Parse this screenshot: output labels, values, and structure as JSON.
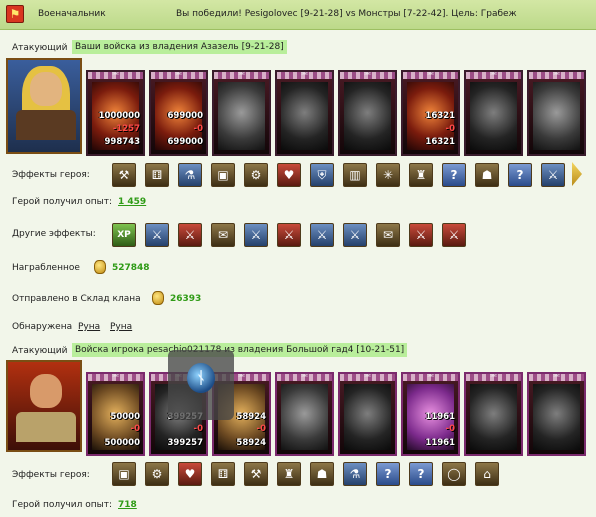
{
  "titlebar": {
    "left_label": "Военачальник",
    "battle_text": "Вы победили! Pesigolovec [9-21-28] vs Монстры [7-22-42]. Цель: Грабеж"
  },
  "attacker1": {
    "role_label": "Атакующий",
    "source_text": "Ваши войска из владения Азазель [9-21-28]",
    "units": [
      {
        "count": "1000000",
        "loss": "-1257",
        "left": "998743"
      },
      {
        "count": "699000",
        "loss": "-0",
        "left": "699000"
      },
      {
        "count": "",
        "loss": "",
        "left": ""
      },
      {
        "count": "",
        "loss": "",
        "left": ""
      },
      {
        "count": "",
        "loss": "",
        "left": ""
      },
      {
        "count": "16321",
        "loss": "-0",
        "left": "16321"
      },
      {
        "count": "",
        "loss": "",
        "left": ""
      },
      {
        "count": "",
        "loss": "",
        "left": ""
      }
    ],
    "hero_effects_label": "Эффекты героя:",
    "hero_effect_icons": [
      "hammer-icon",
      "dice-icon",
      "potion-icon",
      "chest-icon",
      "grinder-icon",
      "heart-icon",
      "shield-icon",
      "barrel-icon",
      "web-icon",
      "armor-icon",
      "question-icon",
      "helmet-icon",
      "question-icon",
      "sword-icon"
    ],
    "exp_label": "Герой получил опыт:",
    "exp_value": "1 459",
    "other_effects_label": "Другие эффекты:",
    "other_effect_icons": [
      "xp-icon",
      "sword-icon",
      "sword-fire-icon",
      "scroll-icon",
      "sword-icon",
      "sword-fire-icon",
      "sword-icon",
      "sword-icon",
      "scroll-icon",
      "sword-fire-icon",
      "sword-fire-icon"
    ],
    "xp_icon_text": "XP",
    "loot_label": "Награбленное",
    "loot_value": "527848",
    "sent_label": "Отправлено в Склад клана",
    "sent_value": "26393",
    "found_label": "Обнаружена",
    "found_items": [
      "Руна",
      "Руна"
    ]
  },
  "attacker2": {
    "role_label": "Атакующий",
    "source_text": "Войска игрока pesachio021178 из владения Большой гад4 [10-21-51]",
    "units": [
      {
        "count": "50000",
        "loss": "-0",
        "left": "500000"
      },
      {
        "count": "399257",
        "loss": "-0",
        "left": "399257"
      },
      {
        "count": "58924",
        "loss": "-0",
        "left": "58924"
      },
      {
        "count": "",
        "loss": "",
        "left": ""
      },
      {
        "count": "",
        "loss": "",
        "left": ""
      },
      {
        "count": "11961",
        "loss": "-0",
        "left": "11961"
      },
      {
        "count": "",
        "loss": "",
        "left": ""
      },
      {
        "count": "",
        "loss": "",
        "left": ""
      }
    ],
    "hero_effects_label": "Эффекты героя:",
    "hero_effect_icons": [
      "chest-icon",
      "grinder-icon",
      "heart-icon",
      "dice-icon",
      "hammer-icon",
      "armor-icon",
      "helmet-icon",
      "potion-icon",
      "question-icon",
      "question-icon",
      "ring-icon",
      "shop-icon"
    ],
    "exp_label": "Герой получил опыт:",
    "exp_value": "718"
  },
  "tooltip": {
    "rune_letter": "ᚾ"
  }
}
